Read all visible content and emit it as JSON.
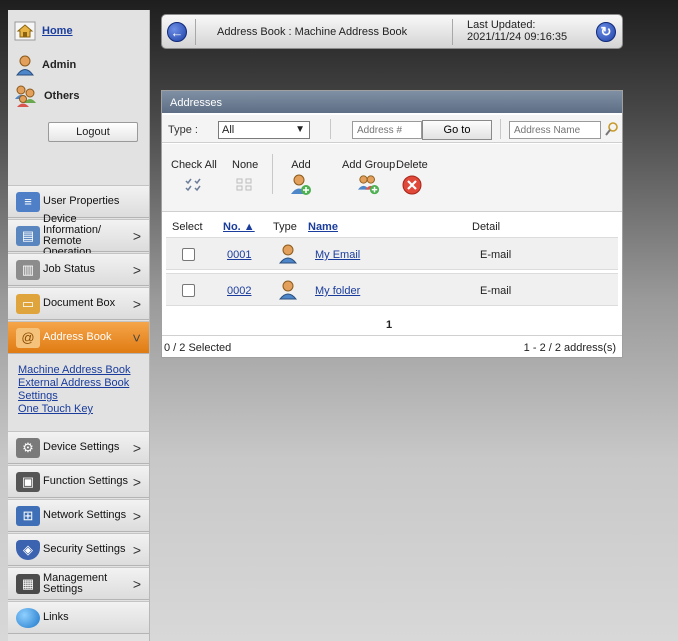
{
  "sidebar": {
    "home": "Home",
    "admin": "Admin",
    "others": "Others",
    "logout": "Logout",
    "menu": [
      {
        "line1": "User Properties",
        "line2": ""
      },
      {
        "line1": "Device Information/",
        "line2": "Remote Operation"
      },
      {
        "line1": "Job Status",
        "line2": ""
      },
      {
        "line1": "Document Box",
        "line2": ""
      },
      {
        "line1": "Address Book",
        "line2": ""
      },
      {
        "line1": "Device Settings",
        "line2": ""
      },
      {
        "line1": "Function Settings",
        "line2": ""
      },
      {
        "line1": "Network Settings",
        "line2": ""
      },
      {
        "line1": "Security Settings",
        "line2": ""
      },
      {
        "line1": "Management",
        "line2": "Settings"
      },
      {
        "line1": "Links",
        "line2": ""
      }
    ],
    "submenu": [
      "Machine Address Book",
      "External Address Book",
      "Settings",
      "One Touch Key"
    ]
  },
  "header": {
    "title": "Address Book : Machine Address Book",
    "last_updated_label": "Last Updated:",
    "last_updated_value": "2021/11/24 09:16:35"
  },
  "panel": {
    "title": "Addresses",
    "type_label": "Type :",
    "type_value": "All",
    "address_num_placeholder": "Address #",
    "goto_label": "Go to",
    "address_name_placeholder": "Address Name",
    "tools": {
      "check_all": "Check All",
      "none": "None",
      "add": "Add",
      "add_group": "Add Group",
      "delete": "Delete"
    },
    "columns": {
      "select": "Select",
      "no": "No. ▲",
      "type": "Type",
      "name": "Name",
      "detail": "Detail"
    },
    "rows": [
      {
        "no": "0001",
        "name": "My Email",
        "detail": "E-mail"
      },
      {
        "no": "0002",
        "name": "My folder",
        "detail": "E-mail"
      }
    ],
    "page": "1",
    "selected": "0 / 2 Selected",
    "range": "1 - 2 / 2 address(s)"
  },
  "colors": {
    "accent_orange": "#e07b12",
    "link_blue": "#1a3c9c",
    "panel_title": "#6a7a90"
  }
}
